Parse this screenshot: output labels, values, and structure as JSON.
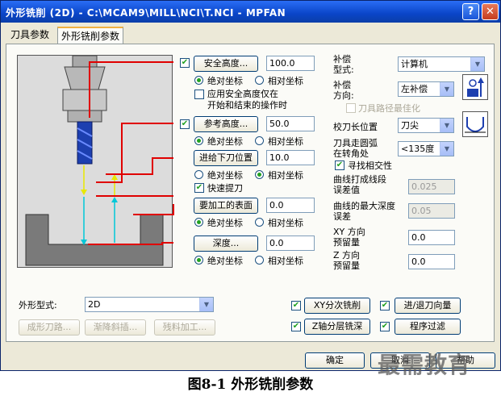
{
  "window": {
    "title": "外形铣削 (2D) - C:\\MCAM9\\MILL\\NCI\\T.NCI - MPFAN",
    "help_label": "?",
    "close_label": "✕"
  },
  "tabs": [
    {
      "label": "刀具参数"
    },
    {
      "label": "外形铣削参数"
    }
  ],
  "left": {
    "safe_height": {
      "button": "安全高度...",
      "value": "100.0",
      "checked": true
    },
    "safe_coord": {
      "abs": "绝对坐标",
      "rel": "相对坐标",
      "selected": "abs"
    },
    "safe_option": {
      "line1": "应用安全高度仅在",
      "line2": "开始和结束的操作时",
      "checked": false
    },
    "ref_height": {
      "button": "参考高度...",
      "value": "50.0",
      "checked": true
    },
    "ref_coord": {
      "abs": "绝对坐标",
      "rel": "相对坐标",
      "selected": "abs"
    },
    "feed_plane": {
      "button": "进给下刀位置",
      "value": "10.0"
    },
    "feed_coord": {
      "abs": "绝对坐标",
      "rel": "相对坐标",
      "selected": "rel"
    },
    "fast_retract": {
      "label": "快速提刀",
      "checked": true
    },
    "top_surface": {
      "button": "要加工的表面",
      "value": "0.0"
    },
    "top_coord": {
      "abs": "绝对坐标",
      "rel": "相对坐标",
      "selected": "abs"
    },
    "depth": {
      "button": "深度...",
      "value": "0.0"
    },
    "depth_coord": {
      "abs": "绝对坐标",
      "rel": "相对坐标",
      "selected": "abs"
    }
  },
  "right": {
    "comp_type": {
      "label1": "补偿",
      "label2": "型式:",
      "value": "计算机"
    },
    "comp_dir": {
      "label1": "补偿",
      "label2": "方向:",
      "value": "左补偿"
    },
    "optimize": {
      "label": "刀具路径最佳化",
      "checked": false
    },
    "tip_comp": {
      "label": "校刀长位置",
      "value": "刀尖"
    },
    "corner": {
      "label1": "刀具走圆弧",
      "label2": "在转角处",
      "value": "<135度"
    },
    "self_intersect": {
      "label": "寻找相交性",
      "checked": true
    },
    "tolerance": {
      "label1": "曲线打成线段",
      "label2": "误差值",
      "value": "0.025"
    },
    "max_depth": {
      "label1": "曲线的最大深度",
      "label2": "误差",
      "value": "0.05"
    },
    "xy_stock": {
      "label1": "XY 方向",
      "label2": "预留量",
      "value": "0.0"
    },
    "z_stock": {
      "label1": "Z 方向",
      "label2": "预留量",
      "value": "0.0"
    }
  },
  "bottom": {
    "contour_type_label": "外形型式:",
    "contour_type_value": "2D",
    "ramp_btn": "成形刀路...",
    "lead_ramp_btn": "渐降斜插...",
    "remachine_btn": "残料加工...",
    "xy_multi": {
      "label": "XY分次铣削",
      "checked": true
    },
    "lead_in_out": {
      "label": "进/退刀向量",
      "checked": true
    },
    "depth_cuts": {
      "label": "Z轴分层铣深",
      "checked": true
    },
    "filter": {
      "label": "程序过滤",
      "checked": true
    },
    "ok": "确定",
    "cancel": "取消",
    "help": "帮助"
  },
  "caption": "图8-1 外形铣削参数",
  "watermark": "最需教育",
  "colors": {
    "accent": "#e00000",
    "tool_blue": "#1d3fb0",
    "arrow_cyan": "#00c8d8",
    "arrow_yellow": "#e8e800"
  }
}
